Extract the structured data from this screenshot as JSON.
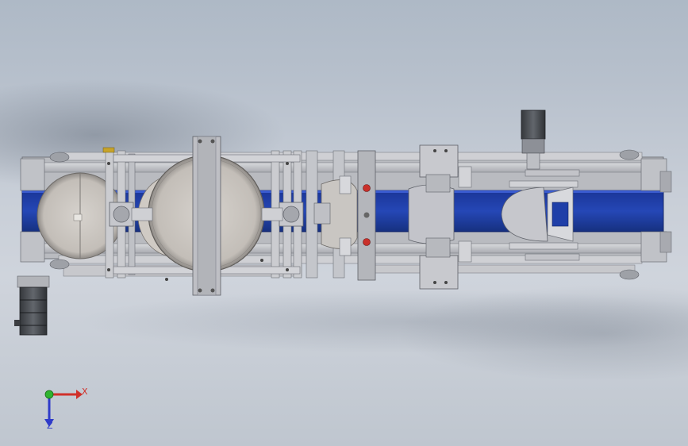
{
  "view": {
    "type": "CAD model viewport",
    "orientation": "top view"
  },
  "triad": {
    "x_label": "X",
    "z_label": "Z"
  },
  "colors": {
    "conveyor_belt": "#1f3fa8",
    "frame_aluminum": "#c4c6cb",
    "disc": "#c9c5c0",
    "motor": "#4a4d52",
    "x_axis": "#d0302a",
    "y_axis": "#2fb42f",
    "z_axis": "#2f3bc9"
  },
  "components": [
    "conveyor-belt",
    "left-disc",
    "large-center-disc",
    "cross-bracket",
    "roller-clamps",
    "servo-motor-top",
    "stepper-motor-left",
    "end-rollers"
  ]
}
